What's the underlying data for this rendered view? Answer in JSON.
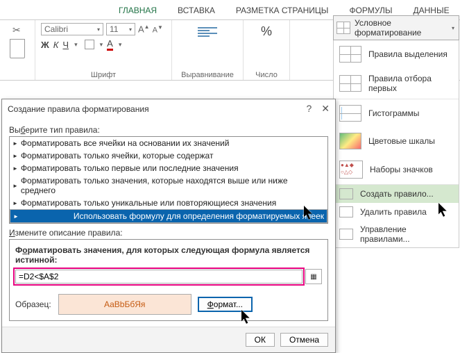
{
  "tabs": {
    "home": "ГЛАВНАЯ",
    "insert": "ВСТАВКА",
    "layout": "РАЗМЕТКА СТРАНИЦЫ",
    "formulas": "ФОРМУЛЫ",
    "data": "ДАННЫЕ"
  },
  "ribbon": {
    "font_name": "Calibri",
    "font_size": "11",
    "bold": "Ж",
    "italic": "К",
    "underline": "Ч",
    "fontgrow": "A",
    "fontshrink": "A",
    "font_label": "Шрифт",
    "align_label": "Выравнивание",
    "num_label": "Число",
    "pct": "%"
  },
  "cf": {
    "header": "Условное форматирование",
    "i1": "Правила выделения",
    "i2": "Правила отбора первых",
    "i3": "Гистограммы",
    "i4": "Цветовые шкалы",
    "i5": "Наборы значков",
    "new": "Создать правило...",
    "del": "Удалить правила",
    "manage": "Управление правилами..."
  },
  "dlg": {
    "title": "Создание правила форматирования",
    "help": "?",
    "close": "✕",
    "type_label": "Выберите тип правила:",
    "r1": "Форматировать все ячейки на основании их значений",
    "r2": "Форматировать только ячейки, которые содержат",
    "r3": "Форматировать только первые или последние значения",
    "r4": "Форматировать только значения, которые находятся выше или ниже среднего",
    "r5": "Форматировать только уникальные или повторяющиеся значения",
    "r6": "Использовать формулу для определения форматируемых ячеек",
    "desc_label": "Измените описание правила:",
    "formula_label": "Форматировать значения, для которых следующая формула является истинной:",
    "formula": "=D2<$A$2",
    "sample_label": "Образец:",
    "sample_text": "АаВbБбЯя",
    "format_btn": "Формат...",
    "ok": "ОК",
    "cancel": "Отмена"
  }
}
